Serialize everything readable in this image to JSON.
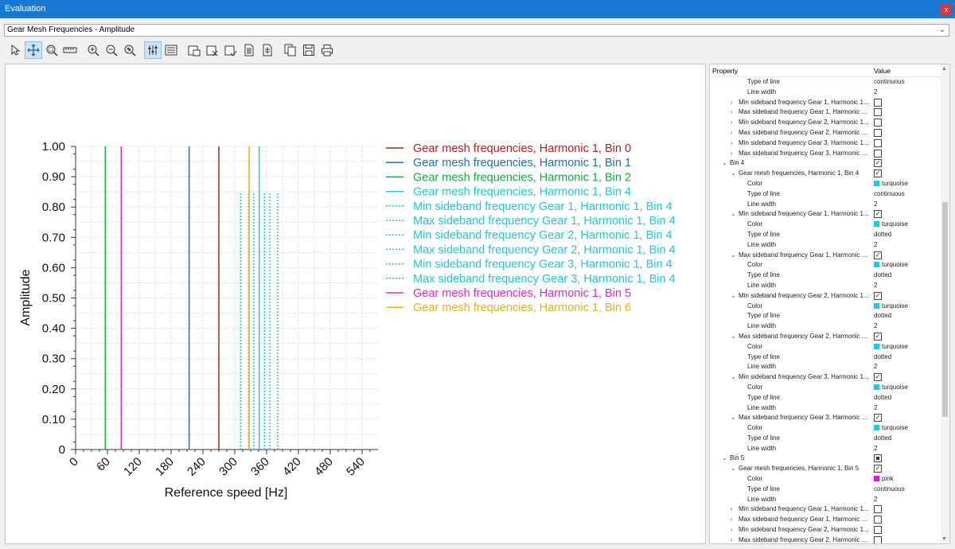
{
  "window": {
    "title": "Evaluation",
    "close": "x"
  },
  "selector": {
    "value": "Gear Mesh Frequencies - Amplitude"
  },
  "toolbar": {
    "buttons": [
      "select-icon",
      "pan-icon",
      "zoom-box-icon",
      "ruler-icon",
      "zoom-in-icon",
      "zoom-out-icon",
      "zoom-fit-icon",
      "cursor-settings-icon",
      "legend-icon",
      "export-image-icon",
      "export-image-2-icon",
      "export-image-3-icon",
      "export-data-icon",
      "export-data-2-icon",
      "copy-icon",
      "save-icon",
      "print-icon"
    ]
  },
  "chart_data": {
    "type": "line",
    "xlabel": "Reference speed [Hz]",
    "ylabel": "Amplitude",
    "xlim": [
      0,
      570
    ],
    "ylim": [
      0,
      1
    ],
    "x_ticks": [
      "0",
      "60",
      "120",
      "180",
      "240",
      "300",
      "360",
      "420",
      "480",
      "540"
    ],
    "y_ticks": [
      "0",
      "0.10",
      "0.20",
      "0.30",
      "0.40",
      "0.50",
      "0.60",
      "0.70",
      "0.80",
      "0.90",
      "1.00"
    ],
    "grid": true,
    "legend_position": "right",
    "series": [
      {
        "name": "Gear mesh frequencies, Harmonic 1, Bin 0",
        "x": 270,
        "amplitude": 1.0,
        "color": "#b22222",
        "style": "solid"
      },
      {
        "name": "Gear mesh frequencies, Harmonic 1, Bin 1",
        "x": 214,
        "amplitude": 1.0,
        "color": "#1f6fb5",
        "style": "solid"
      },
      {
        "name": "Gear mesh frequencies, Harmonic 1, Bin 2",
        "x": 56,
        "amplitude": 1.0,
        "color": "#1aa34a",
        "style": "solid"
      },
      {
        "name": "Gear mesh frequencies, Harmonic 1, Bin 4",
        "x": 346,
        "amplitude": 1.0,
        "color": "#1fc8d4",
        "style": "solid"
      },
      {
        "name": "Min sideband frequency Gear 1, Harmonic 1, Bin 4",
        "x": 311,
        "amplitude": 0.85,
        "color": "#1fc8d4",
        "style": "dotted"
      },
      {
        "name": "Max sideband frequency Gear 1, Harmonic 1, Bin 4",
        "x": 381,
        "amplitude": 0.85,
        "color": "#1fc8d4",
        "style": "dotted"
      },
      {
        "name": "Min sideband frequency Gear 2, Harmonic 1, Bin 4",
        "x": 326,
        "amplitude": 0.85,
        "color": "#1fc8d4",
        "style": "dotted"
      },
      {
        "name": "Max sideband frequency Gear 2, Harmonic 1, Bin 4",
        "x": 366,
        "amplitude": 0.85,
        "color": "#1fc8d4",
        "style": "dotted"
      },
      {
        "name": "Min sideband frequency Gear 3, Harmonic 1, Bin 4",
        "x": 336,
        "amplitude": 0.85,
        "color": "#1fc8d4",
        "style": "dotted"
      },
      {
        "name": "Max sideband frequency Gear 3, Harmonic 1, Bin 4",
        "x": 356,
        "amplitude": 0.85,
        "color": "#1fc8d4",
        "style": "dotted"
      },
      {
        "name": "Gear mesh frequencies, Harmonic 1, Bin 5",
        "x": 86,
        "amplitude": 1.0,
        "color": "#d62fc4",
        "style": "solid"
      },
      {
        "name": "Gear mesh frequencies, Harmonic 1, Bin 6",
        "x": 327,
        "amplitude": 1.0,
        "color": "#e6b01e",
        "style": "solid"
      }
    ]
  },
  "properties": {
    "header_property": "Property",
    "header_value": "Value",
    "rows": [
      {
        "indent": 3,
        "label": "Type of line",
        "value": "continuous"
      },
      {
        "indent": 3,
        "label": "Line width",
        "value": "2"
      },
      {
        "indent": 2,
        "arrow": ">",
        "label": "Min sideband frequency Gear 1, Harmonic 1...",
        "check": "off"
      },
      {
        "indent": 2,
        "arrow": ">",
        "label": "Max sideband frequency Gear 1, Harmonic ...",
        "check": "off"
      },
      {
        "indent": 2,
        "arrow": ">",
        "label": "Min sideband frequency Gear 2, Harmonic 1...",
        "check": "off"
      },
      {
        "indent": 2,
        "arrow": ">",
        "label": "Max sideband frequency Gear 2, Harmonic ...",
        "check": "off"
      },
      {
        "indent": 2,
        "arrow": ">",
        "label": "Min sideband frequency Gear 3, Harmonic 1...",
        "check": "off"
      },
      {
        "indent": 2,
        "arrow": ">",
        "label": "Max sideband frequency Gear 3, Harmonic ...",
        "check": "off"
      },
      {
        "indent": 1,
        "arrow": "v",
        "label": "Bin 4",
        "check": "on"
      },
      {
        "indent": 2,
        "arrow": "v",
        "label": "Gear mesh frequencies, Harmonic 1, Bin 4",
        "check": "on"
      },
      {
        "indent": 3,
        "label": "Color",
        "value": "turquoise",
        "color": "#1fc8e6"
      },
      {
        "indent": 3,
        "label": "Type of line",
        "value": "continuous"
      },
      {
        "indent": 3,
        "label": "Line width",
        "value": "2"
      },
      {
        "indent": 2,
        "arrow": "v",
        "label": "Min sideband frequency Gear 1, Harmonic 1...",
        "check": "on"
      },
      {
        "indent": 3,
        "label": "Color",
        "value": "turquoise",
        "color": "#1fc8e6"
      },
      {
        "indent": 3,
        "label": "Type of line",
        "value": "dotted"
      },
      {
        "indent": 3,
        "label": "Line width",
        "value": "2"
      },
      {
        "indent": 2,
        "arrow": "v",
        "label": "Max sideband frequency Gear 1, Harmonic ...",
        "check": "on"
      },
      {
        "indent": 3,
        "label": "Color",
        "value": "turquoise",
        "color": "#1fc8e6"
      },
      {
        "indent": 3,
        "label": "Type of line",
        "value": "dotted"
      },
      {
        "indent": 3,
        "label": "Line width",
        "value": "2"
      },
      {
        "indent": 2,
        "arrow": "v",
        "label": "Min sideband frequency Gear 2, Harmonic 1...",
        "check": "on"
      },
      {
        "indent": 3,
        "label": "Color",
        "value": "turquoise",
        "color": "#1fc8e6"
      },
      {
        "indent": 3,
        "label": "Type of line",
        "value": "dotted"
      },
      {
        "indent": 3,
        "label": "Line width",
        "value": "2"
      },
      {
        "indent": 2,
        "arrow": "v",
        "label": "Max sideband frequency Gear 2, Harmonic ...",
        "check": "on"
      },
      {
        "indent": 3,
        "label": "Color",
        "value": "turquoise",
        "color": "#1fc8e6"
      },
      {
        "indent": 3,
        "label": "Type of line",
        "value": "dotted"
      },
      {
        "indent": 3,
        "label": "Line width",
        "value": "2"
      },
      {
        "indent": 2,
        "arrow": "v",
        "label": "Min sideband frequency Gear 3, Harmonic 1...",
        "check": "on"
      },
      {
        "indent": 3,
        "label": "Color",
        "value": "turquoise",
        "color": "#1fc8e6"
      },
      {
        "indent": 3,
        "label": "Type of line",
        "value": "dotted"
      },
      {
        "indent": 3,
        "label": "Line width",
        "value": "2"
      },
      {
        "indent": 2,
        "arrow": "v",
        "label": "Max sideband frequency Gear 3, Harmonic ...",
        "check": "on"
      },
      {
        "indent": 3,
        "label": "Color",
        "value": "turquoise",
        "color": "#1fc8e6"
      },
      {
        "indent": 3,
        "label": "Type of line",
        "value": "dotted"
      },
      {
        "indent": 3,
        "label": "Line width",
        "value": "2"
      },
      {
        "indent": 1,
        "arrow": "v",
        "label": "Bin 5",
        "check": "mixed"
      },
      {
        "indent": 2,
        "arrow": "v",
        "label": "Gear mesh frequencies, Harmonic 1, Bin 5",
        "check": "on"
      },
      {
        "indent": 3,
        "label": "Color",
        "value": "pink",
        "color": "#e317d9"
      },
      {
        "indent": 3,
        "label": "Type of line",
        "value": "continuous"
      },
      {
        "indent": 3,
        "label": "Line width",
        "value": "2"
      },
      {
        "indent": 2,
        "arrow": ">",
        "label": "Min sideband frequency Gear 1, Harmonic 1...",
        "check": "off"
      },
      {
        "indent": 2,
        "arrow": ">",
        "label": "Max sideband frequency Gear 1, Harmonic ...",
        "check": "off"
      },
      {
        "indent": 2,
        "arrow": ">",
        "label": "Min sideband frequency Gear 2, Harmonic 1...",
        "check": "off"
      },
      {
        "indent": 2,
        "arrow": ">",
        "label": "Max sideband frequency Gear 2, Harmonic ...",
        "check": "off"
      }
    ]
  }
}
